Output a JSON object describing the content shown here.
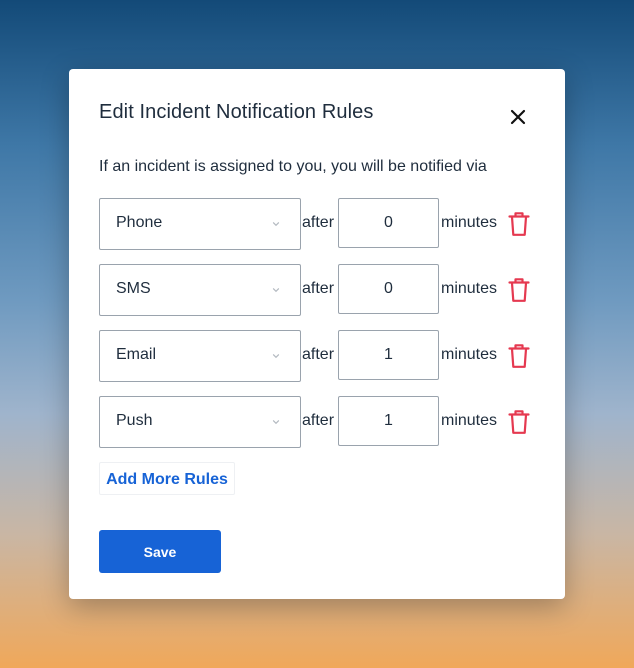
{
  "modal": {
    "title": "Edit Incident Notification Rules",
    "description": "If an incident is assigned to you, you will be notified via",
    "close_icon": "close-icon"
  },
  "rules": [
    {
      "channel": "Phone",
      "after_label": "after",
      "minutes_value": "0",
      "minutes_label": "minutes"
    },
    {
      "channel": "SMS",
      "after_label": "after",
      "minutes_value": "0",
      "minutes_label": "minutes"
    },
    {
      "channel": "Email",
      "after_label": "after",
      "minutes_value": "1",
      "minutes_label": "minutes"
    },
    {
      "channel": "Push",
      "after_label": "after",
      "minutes_value": "1",
      "minutes_label": "minutes"
    }
  ],
  "actions": {
    "add_more_rules_label": "Add More Rules",
    "save_label": "Save"
  },
  "colors": {
    "accent": "#1763d6",
    "delete": "#e53950",
    "text": "#1f2d3d"
  },
  "icons": {
    "dropdown": "chevron-down-icon",
    "delete": "trash-icon"
  }
}
